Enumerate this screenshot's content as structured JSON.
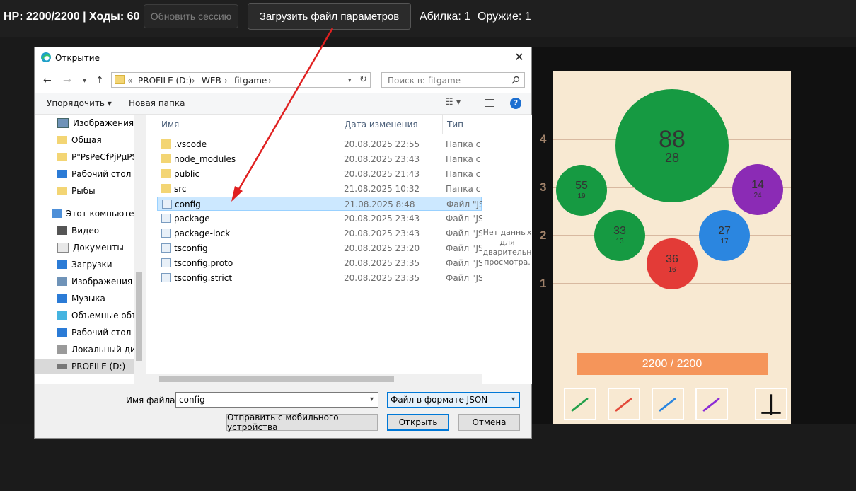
{
  "topbar": {
    "stats": "HP: 2200/2200 | Ходы: 60",
    "refresh_label": "Обновить сессию",
    "load_label": "Загрузить файл параметров",
    "ability": "Абилка: 1",
    "weapon": "Оружие: 1"
  },
  "dialog": {
    "title": "Открытие",
    "path": [
      "PROFILE (D:)",
      "WEB",
      "fitgame"
    ],
    "path_prefix": "«",
    "search_placeholder": "Поиск в: fitgame",
    "organize": "Упорядочить ▾",
    "new_folder": "Новая папка",
    "nav": [
      {
        "label": "Изображения",
        "icon": "pictures-icon"
      },
      {
        "label": "Общая",
        "icon": "folder-icon"
      },
      {
        "label": "P\"PsPeCfPjPµPS",
        "icon": "folder-icon"
      },
      {
        "label": "Рабочий стол",
        "icon": "desktop-icon"
      },
      {
        "label": "Рыбы",
        "icon": "folder-icon"
      },
      {
        "label": "Этот компьютер",
        "icon": "computer-icon"
      },
      {
        "label": "Видео",
        "icon": "video-icon"
      },
      {
        "label": "Документы",
        "icon": "documents-icon"
      },
      {
        "label": "Загрузки",
        "icon": "downloads-icon"
      },
      {
        "label": "Изображения",
        "icon": "pictures-icon"
      },
      {
        "label": "Музыка",
        "icon": "music-icon"
      },
      {
        "label": "Объемные объ",
        "icon": "3d-objects-icon"
      },
      {
        "label": "Рабочий стол",
        "icon": "desktop-icon"
      },
      {
        "label": "Локальный дис",
        "icon": "drive-icon"
      },
      {
        "label": "PROFILE (D:)",
        "icon": "drive-icon"
      }
    ],
    "columns": {
      "name": "Имя",
      "date": "Дата изменения",
      "type": "Тип"
    },
    "files": [
      {
        "name": ".vscode",
        "date": "20.08.2025 22:55",
        "type": "Папка с ф",
        "kind": "folder"
      },
      {
        "name": "node_modules",
        "date": "20.08.2025 23:43",
        "type": "Папка с ф",
        "kind": "folder"
      },
      {
        "name": "public",
        "date": "20.08.2025 21:43",
        "type": "Папка с ф",
        "kind": "folder"
      },
      {
        "name": "src",
        "date": "21.08.2025 10:32",
        "type": "Папка с ф",
        "kind": "folder"
      },
      {
        "name": "config",
        "date": "21.08.2025 8:48",
        "type": "Файл \"JSO",
        "kind": "file"
      },
      {
        "name": "package",
        "date": "20.08.2025 23:43",
        "type": "Файл \"JSO",
        "kind": "file"
      },
      {
        "name": "package-lock",
        "date": "20.08.2025 23:43",
        "type": "Файл \"JSO",
        "kind": "file"
      },
      {
        "name": "tsconfig",
        "date": "20.08.2025 23:20",
        "type": "Файл \"JSO",
        "kind": "file"
      },
      {
        "name": "tsconfig.proto",
        "date": "20.08.2025 23:35",
        "type": "Файл \"JSO",
        "kind": "file"
      },
      {
        "name": "tsconfig.strict",
        "date": "20.08.2025 23:35",
        "type": "Файл \"JSO",
        "kind": "file"
      }
    ],
    "preview_text": "Нет данных для предварительного просмотра.",
    "preview_lines": [
      "Нет данных",
      "для",
      "дварительн",
      "просмотра."
    ],
    "filename_label": "Имя файла:",
    "filename_value": "config",
    "filetype_value": "Файл в формате JSON",
    "mobile_label": "Отправить с мобильного устройства",
    "open_label": "Открыть",
    "cancel_label": "Отмена"
  },
  "game": {
    "lanes": [
      "4",
      "3",
      "2",
      "1"
    ],
    "balls": [
      {
        "value": "88",
        "sub": "28",
        "color": "#169a42"
      },
      {
        "value": "55",
        "sub": "19",
        "color": "#169a42"
      },
      {
        "value": "33",
        "sub": "13",
        "color": "#169a42"
      },
      {
        "value": "36",
        "sub": "16",
        "color": "#e33b37"
      },
      {
        "value": "27",
        "sub": "17",
        "color": "#2b86e0"
      },
      {
        "value": "14",
        "sub": "24",
        "color": "#8b2bb5"
      }
    ],
    "hp_text": "2200 / 2200",
    "tools": [
      {
        "name": "green-line-tool",
        "color": "#22a04a"
      },
      {
        "name": "red-line-tool",
        "color": "#e34a3a"
      },
      {
        "name": "blue-line-tool",
        "color": "#2b86e0"
      },
      {
        "name": "purple-line-tool",
        "color": "#8b2bd6"
      }
    ]
  }
}
